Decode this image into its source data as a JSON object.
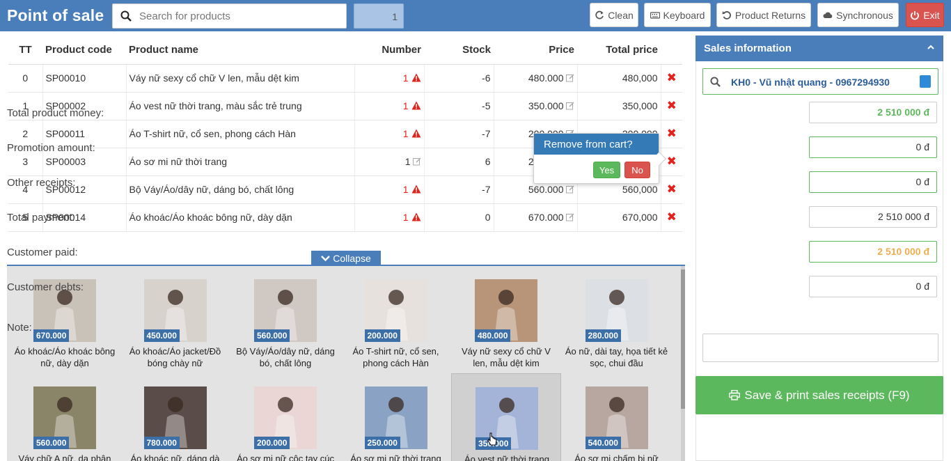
{
  "header": {
    "title": "Point of sale",
    "search_placeholder": "Search for products",
    "quantity": "1",
    "buttons": {
      "clean": "Clean",
      "keyboard": "Keyboard",
      "returns": "Product Returns",
      "sync": "Synchronous",
      "exit": "Exit"
    }
  },
  "cart": {
    "columns": [
      "TT",
      "Product code",
      "Product name",
      "Number",
      "Stock",
      "Price",
      "Total price"
    ],
    "rows": [
      {
        "tt": "0",
        "code": "SP00010",
        "name": "Váy nữ sexy cổ chữ V len, mẫu dệt kim",
        "number": "1",
        "warn": true,
        "stock": "-6",
        "price": "480.000",
        "total": "480,000"
      },
      {
        "tt": "1",
        "code": "SP00002",
        "name": "Áo vest nữ thời trang, màu sắc trẻ trung",
        "number": "1",
        "warn": true,
        "stock": "-5",
        "price": "350.000",
        "total": "350,000"
      },
      {
        "tt": "2",
        "code": "SP00011",
        "name": "Áo T-shirt nữ, cổ sen, phong cách Hàn",
        "number": "1",
        "warn": true,
        "stock": "-7",
        "price": "200.000",
        "total": "200,000"
      },
      {
        "tt": "3",
        "code": "SP00003",
        "name": "Áo sơ mi nữ thời trang",
        "number": "1",
        "warn": false,
        "stock": "6",
        "price": "250.000",
        "total": "250,000"
      },
      {
        "tt": "4",
        "code": "SP00012",
        "name": "Bộ Váy/Áo/dây nữ, dáng bó, chất lông",
        "number": "1",
        "warn": true,
        "stock": "-7",
        "price": "560.000",
        "total": "560,000"
      },
      {
        "tt": "5",
        "code": "SP00014",
        "name": "Áo khoác/Áo khoác bông nữ, dày dặn",
        "number": "1",
        "warn": true,
        "stock": "0",
        "price": "670.000",
        "total": "670,000"
      }
    ]
  },
  "popover": {
    "title": "Remove from cart?",
    "yes": "Yes",
    "no": "No"
  },
  "collapse_label": "Collapse",
  "products": [
    {
      "price": "670.000",
      "name": "Áo khoác/Áo khoác bông nữ, dày dặn",
      "color": "#c9c2b8"
    },
    {
      "price": "450.000",
      "name": "Áo khoác/Áo jacket/Đồ bóng chày nữ",
      "color": "#d8d2cc"
    },
    {
      "price": "560.000",
      "name": "Bộ Váy/Áo/dây nữ, dáng bó, chất lông",
      "color": "#cfc8c3"
    },
    {
      "price": "200.000",
      "name": "Áo T-shirt nữ, cổ sen, phong cách Hàn",
      "color": "#e6e1dd"
    },
    {
      "price": "480.000",
      "name": "Váy nữ sexy cổ chữ V len, mẫu dệt kim",
      "color": "#b89478"
    },
    {
      "price": "280.000",
      "name": "Áo nữ, dài tay, họa tiết kẻ sọc, chui đầu",
      "color": "#dcdfe4"
    },
    {
      "price": "560.000",
      "name": "Váy chữ A nữ, da phân",
      "color": "#8a8468"
    },
    {
      "price": "780.000",
      "name": "Áo khoác nữ, dáng dà",
      "color": "#5a4c48"
    },
    {
      "price": "200.000",
      "name": "Áo sơ mi nữ cộc tay cúc",
      "color": "#e9d6d5"
    },
    {
      "price": "250.000",
      "name": "Áo sơ mi nữ thời trang",
      "color": "#8aa3c4"
    },
    {
      "price": "350.000",
      "name": "Áo vest nữ thời trang",
      "color": "#a3b4d8"
    },
    {
      "price": "540.000",
      "name": "Áo sơ mi chấm bi nữ",
      "color": "#b7a7a0"
    }
  ],
  "sales": {
    "header": "Sales information",
    "customer": "KH0 - Vũ nhật quang - 0967294930",
    "total_product_money_label": "Total product money:",
    "total_product_money": "2 510 000 đ",
    "promotion_label": "Promotion amount:",
    "promotion": "0 đ",
    "other_receipts_label": "Other receipts:",
    "other_receipts": "0 đ",
    "total_payment_label": "Total payment:",
    "total_payment": "2 510 000 đ",
    "customer_paid_label": "Customer paid:",
    "customer_paid": "2 510 000 đ",
    "customer_debts_label": "Customer debts:",
    "customer_debts": "0 đ",
    "note_label": "Note:",
    "save_label": "Save & print sales receipts (F9)"
  },
  "colors": {
    "brand": "#4a7ebb",
    "success": "#5cb85c",
    "danger": "#d9534f",
    "warning": "#f0ad4e"
  }
}
